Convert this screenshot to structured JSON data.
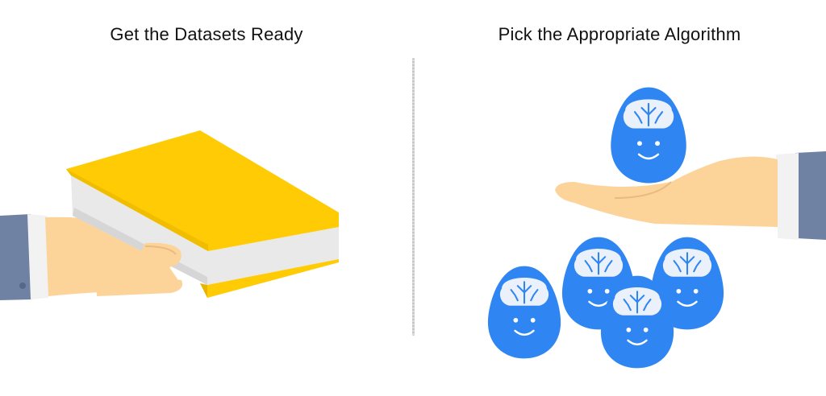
{
  "left_panel": {
    "title": "Get the Datasets Ready"
  },
  "right_panel": {
    "title": "Pick the Appropriate Algorithm"
  },
  "colors": {
    "book_cover": "#ffcb05",
    "book_pages": "#e6e6e6",
    "skin": "#fcd49a",
    "sleeve": "#6f82a3",
    "cuff": "#f2f2f2",
    "egg_blue": "#2f86f3",
    "brain": "#eaf1fb"
  },
  "icons": [
    "hand-with-book-icon",
    "hand-with-egg-icon",
    "algorithm-egg-icon"
  ]
}
